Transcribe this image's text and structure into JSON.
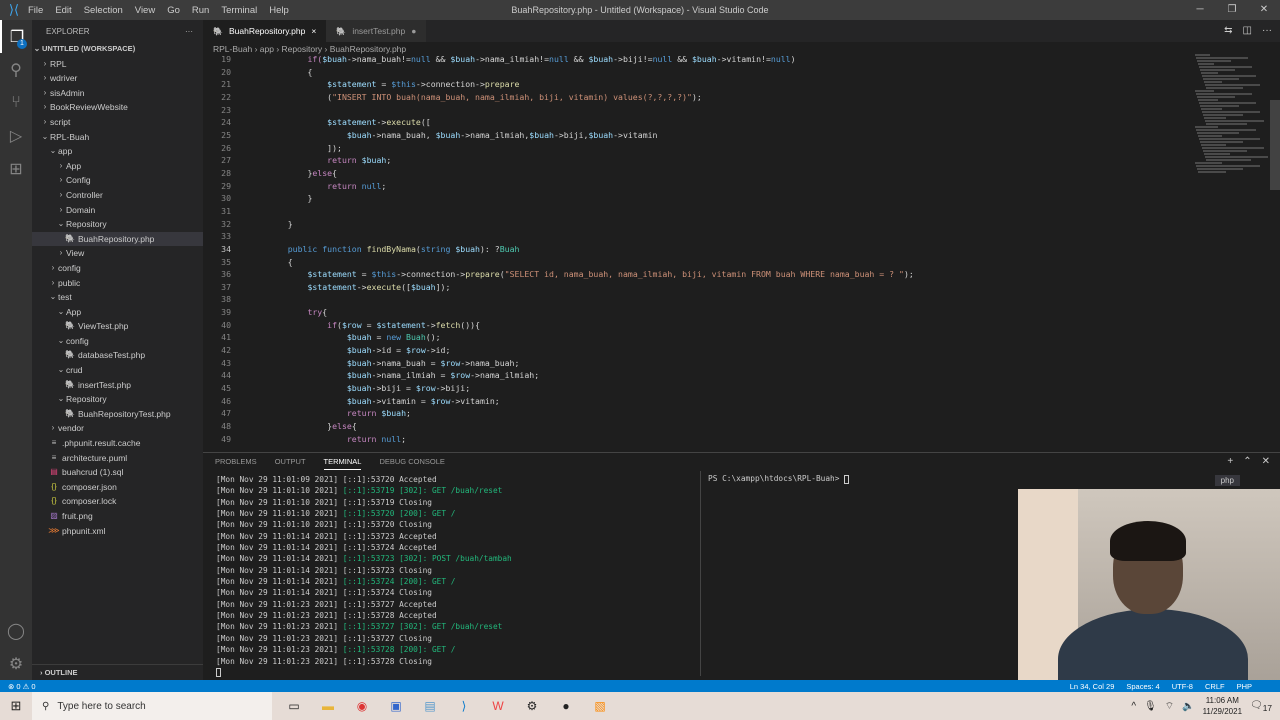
{
  "window": {
    "title": "BuahRepository.php - Untitled (Workspace) - Visual Studio Code",
    "menu": [
      "File",
      "Edit",
      "Selection",
      "View",
      "Go",
      "Run",
      "Terminal",
      "Help"
    ]
  },
  "activity": {
    "badge": "1"
  },
  "sidebar": {
    "title": "EXPLORER",
    "more": "···",
    "workspace": "UNTITLED (WORKSPACE)",
    "items": [
      {
        "label": "RPL",
        "depth": 0,
        "kind": "folder-closed"
      },
      {
        "label": "wdriver",
        "depth": 0,
        "kind": "folder-closed"
      },
      {
        "label": "sisAdmin",
        "depth": 0,
        "kind": "folder-closed"
      },
      {
        "label": "BookReviewWebsite",
        "depth": 0,
        "kind": "folder-closed"
      },
      {
        "label": "script",
        "depth": 0,
        "kind": "folder-closed"
      },
      {
        "label": "RPL-Buah",
        "depth": 0,
        "kind": "folder-open"
      },
      {
        "label": "app",
        "depth": 1,
        "kind": "folder-open"
      },
      {
        "label": "App",
        "depth": 2,
        "kind": "folder-closed"
      },
      {
        "label": "Config",
        "depth": 2,
        "kind": "folder-closed"
      },
      {
        "label": "Controller",
        "depth": 2,
        "kind": "folder-closed"
      },
      {
        "label": "Domain",
        "depth": 2,
        "kind": "folder-closed"
      },
      {
        "label": "Repository",
        "depth": 2,
        "kind": "folder-open"
      },
      {
        "label": "BuahRepository.php",
        "depth": 3,
        "kind": "php",
        "selected": true
      },
      {
        "label": "View",
        "depth": 2,
        "kind": "folder-closed"
      },
      {
        "label": "config",
        "depth": 1,
        "kind": "folder-closed"
      },
      {
        "label": "public",
        "depth": 1,
        "kind": "folder-closed"
      },
      {
        "label": "test",
        "depth": 1,
        "kind": "folder-open"
      },
      {
        "label": "App",
        "depth": 2,
        "kind": "folder-open"
      },
      {
        "label": "ViewTest.php",
        "depth": 3,
        "kind": "php"
      },
      {
        "label": "config",
        "depth": 2,
        "kind": "folder-open"
      },
      {
        "label": "databaseTest.php",
        "depth": 3,
        "kind": "php"
      },
      {
        "label": "crud",
        "depth": 2,
        "kind": "folder-open"
      },
      {
        "label": "insertTest.php",
        "depth": 3,
        "kind": "php"
      },
      {
        "label": "Repository",
        "depth": 2,
        "kind": "folder-open"
      },
      {
        "label": "BuahRepositoryTest.php",
        "depth": 3,
        "kind": "php"
      },
      {
        "label": "vendor",
        "depth": 1,
        "kind": "folder-closed"
      },
      {
        "label": ".phpunit.result.cache",
        "depth": 1,
        "kind": "text"
      },
      {
        "label": "architecture.puml",
        "depth": 1,
        "kind": "text"
      },
      {
        "label": "buahcrud (1).sql",
        "depth": 1,
        "kind": "sql"
      },
      {
        "label": "composer.json",
        "depth": 1,
        "kind": "json"
      },
      {
        "label": "composer.lock",
        "depth": 1,
        "kind": "json"
      },
      {
        "label": "fruit.png",
        "depth": 1,
        "kind": "image"
      },
      {
        "label": "phpunit.xml",
        "depth": 1,
        "kind": "xml"
      }
    ],
    "outline": "OUTLINE"
  },
  "tabs": [
    {
      "label": "BuahRepository.php",
      "active": true,
      "close": "×"
    },
    {
      "label": "insertTest.php",
      "active": false,
      "close": "●"
    }
  ],
  "breadcrumb": [
    "RPL-Buah",
    "app",
    "Repository",
    "BuahRepository.php"
  ],
  "editor": {
    "current_line": "34",
    "lines": [
      {
        "n": "19",
        "i": 2,
        "t": [
          [
            "ctl",
            "if("
          ],
          [
            "var",
            "$buah"
          ],
          [
            "p",
            "->nama_buah!="
          ],
          [
            "kw",
            "null"
          ],
          [
            "p",
            " && "
          ],
          [
            "var",
            "$buah"
          ],
          [
            "p",
            "->nama_ilmiah!="
          ],
          [
            "kw",
            "null"
          ],
          [
            "p",
            " && "
          ],
          [
            "var",
            "$buah"
          ],
          [
            "p",
            "->biji!="
          ],
          [
            "kw",
            "null"
          ],
          [
            "p",
            " && "
          ],
          [
            "var",
            "$buah"
          ],
          [
            "p",
            "->vitamin!="
          ],
          [
            "kw",
            "null"
          ],
          [
            "p",
            ")"
          ]
        ]
      },
      {
        "n": "20",
        "i": 2,
        "t": [
          [
            "p",
            "{"
          ]
        ]
      },
      {
        "n": "21",
        "i": 3,
        "t": [
          [
            "var",
            "$statement"
          ],
          [
            "p",
            " = "
          ],
          [
            "kw",
            "$this"
          ],
          [
            "p",
            "->connection->"
          ],
          [
            "fn",
            "prepare"
          ]
        ]
      },
      {
        "n": "22",
        "i": 3,
        "t": [
          [
            "p",
            "("
          ],
          [
            "str",
            "\"INSERT INTO buah(nama_buah, nama_ilmiah, biji, vitamin) values(?,?,?,?)\""
          ],
          [
            "p",
            ");"
          ]
        ]
      },
      {
        "n": "23",
        "i": 0,
        "t": []
      },
      {
        "n": "24",
        "i": 3,
        "t": [
          [
            "var",
            "$statement"
          ],
          [
            "p",
            "->"
          ],
          [
            "fn",
            "execute"
          ],
          [
            "p",
            "(["
          ]
        ]
      },
      {
        "n": "25",
        "i": 4,
        "t": [
          [
            "var",
            "$buah"
          ],
          [
            "p",
            "->nama_buah, "
          ],
          [
            "var",
            "$buah"
          ],
          [
            "p",
            "->nama_ilmiah,"
          ],
          [
            "var",
            "$buah"
          ],
          [
            "p",
            "->biji,"
          ],
          [
            "var",
            "$buah"
          ],
          [
            "p",
            "->vitamin"
          ]
        ]
      },
      {
        "n": "26",
        "i": 3,
        "t": [
          [
            "p",
            "]);"
          ]
        ]
      },
      {
        "n": "27",
        "i": 3,
        "t": [
          [
            "ctl",
            "return "
          ],
          [
            "var",
            "$buah"
          ],
          [
            "p",
            ";"
          ]
        ]
      },
      {
        "n": "28",
        "i": 2,
        "t": [
          [
            "p",
            "}"
          ],
          [
            "ctl",
            "else"
          ],
          [
            "p",
            "{"
          ]
        ]
      },
      {
        "n": "29",
        "i": 3,
        "t": [
          [
            "ctl",
            "return "
          ],
          [
            "kw",
            "null"
          ],
          [
            "p",
            ";"
          ]
        ]
      },
      {
        "n": "30",
        "i": 2,
        "t": [
          [
            "p",
            "}"
          ]
        ]
      },
      {
        "n": "31",
        "i": 0,
        "t": []
      },
      {
        "n": "32",
        "i": 1,
        "t": [
          [
            "p",
            "}"
          ]
        ]
      },
      {
        "n": "33",
        "i": 0,
        "t": []
      },
      {
        "n": "34",
        "i": 1,
        "t": [
          [
            "kw",
            "public function "
          ],
          [
            "fn",
            "findByNama"
          ],
          [
            "p",
            "("
          ],
          [
            "kw",
            "string "
          ],
          [
            "var",
            "$buah"
          ],
          [
            "p",
            "): ?"
          ],
          [
            "type",
            "Buah"
          ]
        ]
      },
      {
        "n": "35",
        "i": 1,
        "t": [
          [
            "p",
            "{"
          ]
        ]
      },
      {
        "n": "36",
        "i": 2,
        "t": [
          [
            "var",
            "$statement"
          ],
          [
            "p",
            " = "
          ],
          [
            "kw",
            "$this"
          ],
          [
            "p",
            "->connection->"
          ],
          [
            "fn",
            "prepare"
          ],
          [
            "p",
            "("
          ],
          [
            "str",
            "\"SELECT id, nama_buah, nama_ilmiah, biji, vitamin FROM buah WHERE nama_buah = ? \""
          ],
          [
            "p",
            ");"
          ]
        ]
      },
      {
        "n": "37",
        "i": 2,
        "t": [
          [
            "var",
            "$statement"
          ],
          [
            "p",
            "->"
          ],
          [
            "fn",
            "execute"
          ],
          [
            "p",
            "(["
          ],
          [
            "var",
            "$buah"
          ],
          [
            "p",
            "]);"
          ]
        ]
      },
      {
        "n": "38",
        "i": 0,
        "t": []
      },
      {
        "n": "39",
        "i": 2,
        "t": [
          [
            "ctl",
            "try"
          ],
          [
            "p",
            "{"
          ]
        ]
      },
      {
        "n": "40",
        "i": 3,
        "t": [
          [
            "ctl",
            "if"
          ],
          [
            "p",
            "("
          ],
          [
            "var",
            "$row"
          ],
          [
            "p",
            " = "
          ],
          [
            "var",
            "$statement"
          ],
          [
            "p",
            "->"
          ],
          [
            "fn",
            "fetch"
          ],
          [
            "p",
            "()){"
          ]
        ]
      },
      {
        "n": "41",
        "i": 4,
        "t": [
          [
            "var",
            "$buah"
          ],
          [
            "p",
            " = "
          ],
          [
            "kw",
            "new "
          ],
          [
            "type",
            "Buah"
          ],
          [
            "p",
            "();"
          ]
        ]
      },
      {
        "n": "42",
        "i": 4,
        "t": [
          [
            "var",
            "$buah"
          ],
          [
            "p",
            "->id = "
          ],
          [
            "var",
            "$row"
          ],
          [
            "p",
            "->id;"
          ]
        ]
      },
      {
        "n": "43",
        "i": 4,
        "t": [
          [
            "var",
            "$buah"
          ],
          [
            "p",
            "->nama_buah = "
          ],
          [
            "var",
            "$row"
          ],
          [
            "p",
            "->nama_buah;"
          ]
        ]
      },
      {
        "n": "44",
        "i": 4,
        "t": [
          [
            "var",
            "$buah"
          ],
          [
            "p",
            "->nama_ilmiah = "
          ],
          [
            "var",
            "$row"
          ],
          [
            "p",
            "->nama_ilmiah;"
          ]
        ]
      },
      {
        "n": "45",
        "i": 4,
        "t": [
          [
            "var",
            "$buah"
          ],
          [
            "p",
            "->biji = "
          ],
          [
            "var",
            "$row"
          ],
          [
            "p",
            "->biji;"
          ]
        ]
      },
      {
        "n": "46",
        "i": 4,
        "t": [
          [
            "var",
            "$buah"
          ],
          [
            "p",
            "->vitamin = "
          ],
          [
            "var",
            "$row"
          ],
          [
            "p",
            "->vitamin;"
          ]
        ]
      },
      {
        "n": "47",
        "i": 4,
        "t": [
          [
            "ctl",
            "return "
          ],
          [
            "var",
            "$buah"
          ],
          [
            "p",
            ";"
          ]
        ]
      },
      {
        "n": "48",
        "i": 3,
        "t": [
          [
            "p",
            "}"
          ],
          [
            "ctl",
            "else"
          ],
          [
            "p",
            "{"
          ]
        ]
      },
      {
        "n": "49",
        "i": 4,
        "t": [
          [
            "ctl",
            "return "
          ],
          [
            "kw",
            "null"
          ],
          [
            "p",
            ";"
          ]
        ]
      }
    ]
  },
  "panel": {
    "tabs": [
      "PROBLEMS",
      "OUTPUT",
      "TERMINAL",
      "DEBUG CONSOLE"
    ],
    "active_tab": "TERMINAL",
    "shell": "php",
    "terminal": [
      {
        "ts": "[Mon Nov 29 11:01:09 2021]",
        "msg": "[::1]:53720 Accepted",
        "g": false
      },
      {
        "ts": "[Mon Nov 29 11:01:10 2021]",
        "msg": "[::1]:53719 [302]: GET /buah/reset",
        "g": true
      },
      {
        "ts": "[Mon Nov 29 11:01:10 2021]",
        "msg": "[::1]:53719 Closing",
        "g": false
      },
      {
        "ts": "[Mon Nov 29 11:01:10 2021]",
        "msg": "[::1]:53720 [200]: GET /",
        "g": true
      },
      {
        "ts": "[Mon Nov 29 11:01:10 2021]",
        "msg": "[::1]:53720 Closing",
        "g": false
      },
      {
        "ts": "[Mon Nov 29 11:01:14 2021]",
        "msg": "[::1]:53723 Accepted",
        "g": false
      },
      {
        "ts": "[Mon Nov 29 11:01:14 2021]",
        "msg": "[::1]:53724 Accepted",
        "g": false
      },
      {
        "ts": "[Mon Nov 29 11:01:14 2021]",
        "msg": "[::1]:53723 [302]: POST /buah/tambah",
        "g": true
      },
      {
        "ts": "[Mon Nov 29 11:01:14 2021]",
        "msg": "[::1]:53723 Closing",
        "g": false
      },
      {
        "ts": "[Mon Nov 29 11:01:14 2021]",
        "msg": "[::1]:53724 [200]: GET /",
        "g": true
      },
      {
        "ts": "[Mon Nov 29 11:01:14 2021]",
        "msg": "[::1]:53724 Closing",
        "g": false
      },
      {
        "ts": "[Mon Nov 29 11:01:23 2021]",
        "msg": "[::1]:53727 Accepted",
        "g": false
      },
      {
        "ts": "[Mon Nov 29 11:01:23 2021]",
        "msg": "[::1]:53728 Accepted",
        "g": false
      },
      {
        "ts": "[Mon Nov 29 11:01:23 2021]",
        "msg": "[::1]:53727 [302]: GET /buah/reset",
        "g": true
      },
      {
        "ts": "[Mon Nov 29 11:01:23 2021]",
        "msg": "[::1]:53727 Closing",
        "g": false
      },
      {
        "ts": "[Mon Nov 29 11:01:23 2021]",
        "msg": "[::1]:53728 [200]: GET /",
        "g": true
      },
      {
        "ts": "[Mon Nov 29 11:01:23 2021]",
        "msg": "[::1]:53728 Closing",
        "g": false
      }
    ],
    "prompt": "PS C:\\xampp\\htdocs\\RPL-Buah>"
  },
  "statusbar": {
    "problems": "⊗ 0 ⚠ 0",
    "position": "Ln 34, Col 29",
    "spaces": "Spaces: 4",
    "encoding": "UTF-8",
    "eol": "CRLF",
    "language": "PHP"
  },
  "taskbar": {
    "search_placeholder": "Type here to search",
    "time": "11:06 AM",
    "date": "11/29/2021",
    "notifications": "17"
  }
}
